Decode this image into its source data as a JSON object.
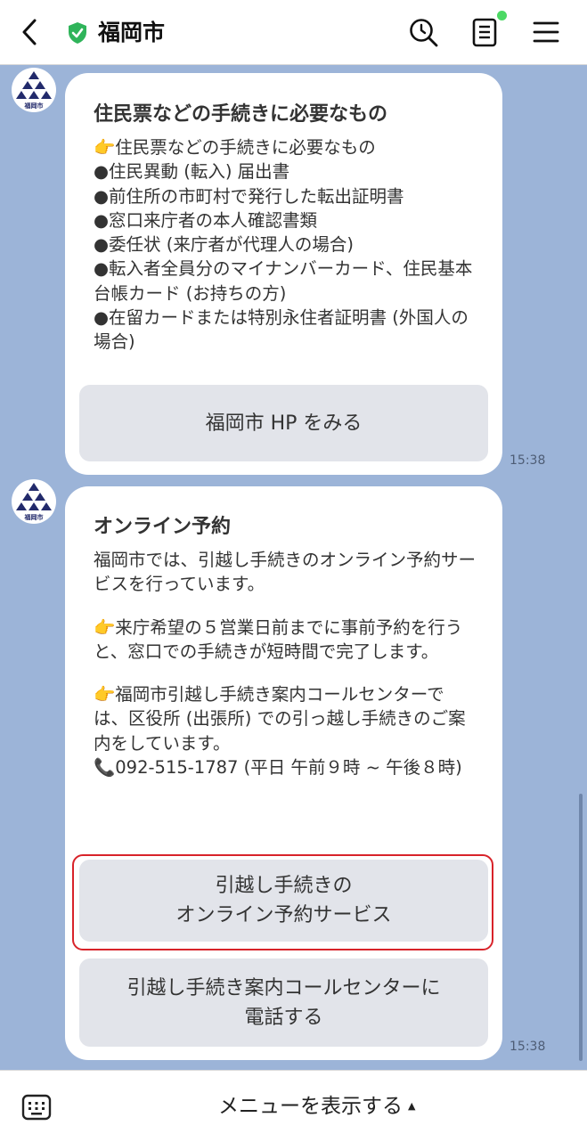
{
  "header": {
    "title": "福岡市",
    "icons": [
      "back-arrow-icon",
      "verified-shield-icon",
      "search-icon",
      "notes-icon",
      "menu-icon"
    ],
    "status_dot_color": "#4cd964"
  },
  "messages": [
    {
      "sender_icon": "fukuoka-city-logo",
      "logo_text": "福岡市",
      "title": "住民票などの手続きに必要なもの",
      "lines": [
        "👉住民票などの手続きに必要なもの",
        "●住民異動 (転入) 届出書",
        "●前住所の市町村で発行した転出証明書",
        "●窓口来庁者の本人確認書類",
        "●委任状 (来庁者が代理人の場合)",
        "●転入者全員分のマイナンバーカード、住民基本台帳カード (お持ちの方)",
        "●在留カードまたは特別永住者証明書 (外国人の場合)"
      ],
      "button": "福岡市 HP をみる",
      "time": "15:38"
    },
    {
      "sender_icon": "fukuoka-city-logo",
      "logo_text": "福岡市",
      "title": "オンライン予約",
      "paragraphs": [
        "福岡市では、引越し手続きのオンライン予約サービスを行っています。",
        "👉来庁希望の５営業日前までに事前予約を行うと、窓口での手続きが短時間で完了します。",
        "👉福岡市引越し手続き案内コールセンターでは、区役所 (出張所) での引っ越し手続きのご案内をしています。",
        "📞092-515-1787 (平日 午前９時 ~ 午後８時)"
      ],
      "buttons": [
        {
          "line1": "引越し手続きの",
          "line2": "オンライン予約サービス"
        },
        {
          "line1": "引越し手続き案内コールセンターに",
          "line2": "電話する"
        }
      ],
      "time": "15:38"
    }
  ],
  "footer": {
    "menu_label": "メニューを表示する",
    "caret": "▲",
    "icons": [
      "keyboard-icon"
    ]
  },
  "colors": {
    "chat_background": "#9cb4d8",
    "button_background": "#e2e4ea",
    "highlight": "#d8232a"
  }
}
